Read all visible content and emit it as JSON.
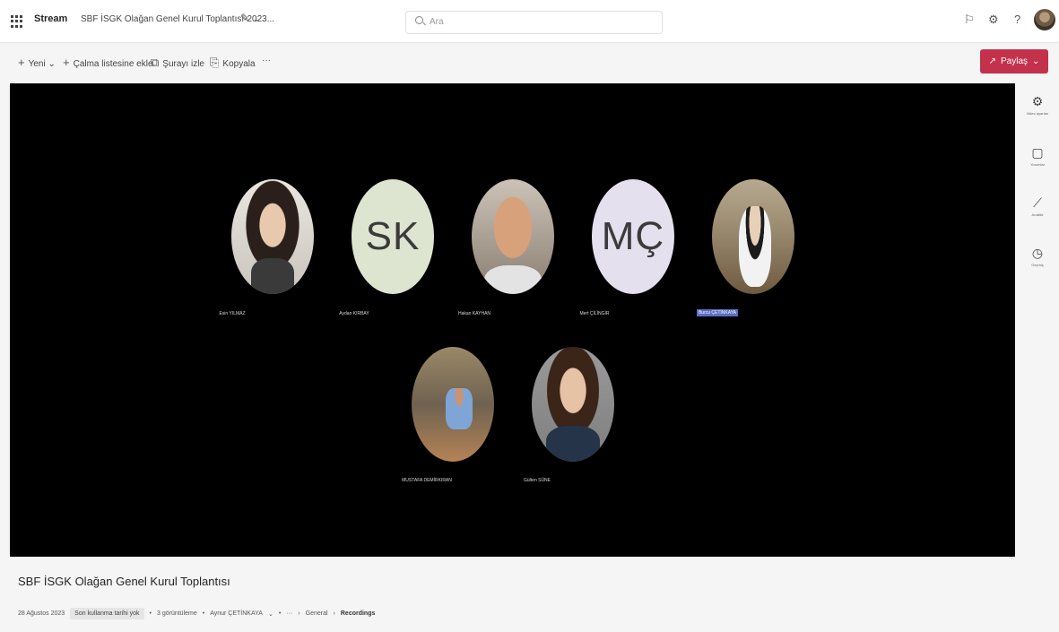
{
  "header": {
    "app_name": "Stream",
    "doc_title": "SBF İSGK Olağan Genel Kurul Toplantısı-2023...",
    "search_placeholder": "Ara",
    "icons": [
      "feedback-icon",
      "settings-icon",
      "help-icon"
    ]
  },
  "commands": {
    "new_label": "Yeni",
    "add_to_playlist_label": "Çalma listesine ekle",
    "watch_label": "Şurayı izle",
    "copy_label": "Kopyala",
    "more_label": "···",
    "share_label": "Paylaş"
  },
  "participants": [
    {
      "name": "Esin YILMAZ",
      "initials": "",
      "photo": true,
      "highlight": false
    },
    {
      "name": "Aydan KIRBAY",
      "initials": "SK",
      "photo": false,
      "highlight": false
    },
    {
      "name": "Hakan KAYHAN",
      "initials": "",
      "photo": true,
      "highlight": false
    },
    {
      "name": "Mert ÇİLİNGİR",
      "initials": "MÇ",
      "photo": false,
      "highlight": false
    },
    {
      "name": "Burcu ÇETİNKAYA",
      "initials": "",
      "photo": true,
      "highlight": true
    },
    {
      "name": "MUSTAFA DEMİRKIRAN",
      "initials": "",
      "photo": true,
      "highlight": false
    },
    {
      "name": "Gülten SÜNE",
      "initials": "",
      "photo": true,
      "highlight": false
    }
  ],
  "rail": [
    {
      "icon": "video-settings-icon",
      "label": "Video ayarları"
    },
    {
      "icon": "comments-icon",
      "label": "Yorumlar"
    },
    {
      "icon": "analytics-icon",
      "label": "Analitik"
    },
    {
      "icon": "history-icon",
      "label": "Geçmiş"
    }
  ],
  "footer": {
    "title": "SBF İSGK Olağan Genel Kurul Toplantısı",
    "date": "28 Ağustos 2023",
    "chip": "Son kullanma tarihi yok",
    "views": "3 görüntüleme",
    "owner": "Aynur ÇETİNKAYA",
    "crumb_general": "General",
    "crumb_recordings": "Recordings"
  },
  "colors": {
    "brand_red": "#c4314b",
    "video_bg": "#000000",
    "highlight": "#5b6ec5"
  }
}
